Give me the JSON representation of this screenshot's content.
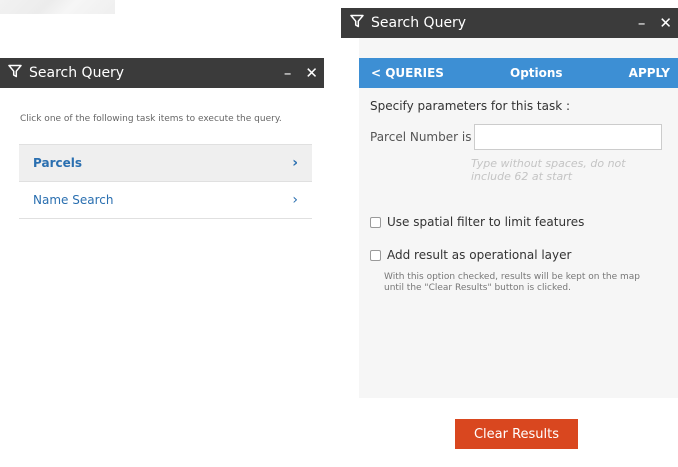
{
  "left_panel": {
    "title": "Search Query",
    "minimize": "–",
    "close": "✕",
    "instruction": "Click one of the following task items to execute the query.",
    "tasks": [
      {
        "label": "Parcels",
        "chevron": "›"
      },
      {
        "label": "Name Search",
        "chevron": "›"
      }
    ]
  },
  "right_panel": {
    "title": "Search Query",
    "minimize": "–",
    "close": "✕",
    "nav": {
      "back": "< QUERIES",
      "center": "Options",
      "apply": "APPLY"
    },
    "spec_text": "Specify parameters for this task :",
    "param_label": "Parcel Number is",
    "param_value": "",
    "param_hint": "Type without spaces, do not include 62 at start",
    "option_spatial": "Use spatial filter to limit features",
    "option_layer": "Add result as operational layer",
    "layer_note": "With this option checked, results will be kept on the map until the \"Clear Results\" button is clicked."
  },
  "clear_button": "Clear Results",
  "colors": {
    "titlebar": "#3b3b3b",
    "navbar": "#3d8fd4",
    "clear_button": "#d9471f",
    "link": "#2a6fb0"
  },
  "icons": {
    "filter": "filter-icon",
    "minimize": "minimize-icon",
    "close": "close-icon",
    "chevron": "chevron-right-icon"
  }
}
